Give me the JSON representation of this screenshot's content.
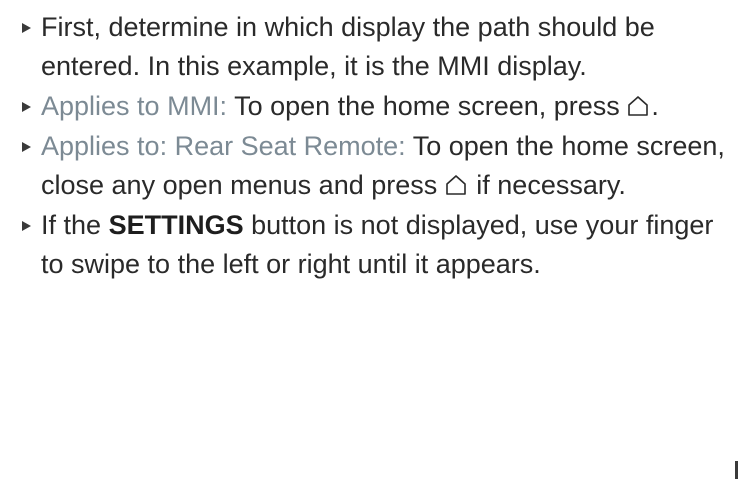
{
  "steps": [
    {
      "text": "First, determine in which display the path should be entered. In this example, it is the MMI display."
    },
    {
      "applies": "Applies to MMI:",
      "before_icon": "To open the home screen, press",
      "icon": "home-icon",
      "after_icon": "."
    },
    {
      "applies": "Applies to: Rear Seat Remote:",
      "before_icon": "To open the home screen, close any open menus and press",
      "icon": "home-icon",
      "after_icon": "if necessary."
    },
    {
      "before_bold": "If the",
      "bold": "SETTINGS",
      "after_bold": "button is not displayed, use your finger to swipe to the left or right until it appears."
    }
  ],
  "colors": {
    "text": "#2a2a2a",
    "applies": "#7c8a94",
    "background": "#ffffff"
  }
}
